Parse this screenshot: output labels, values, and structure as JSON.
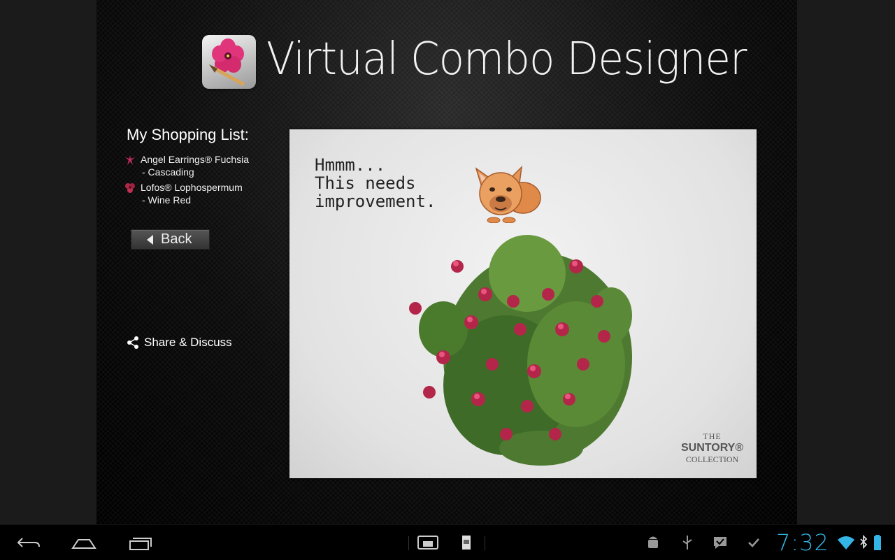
{
  "app": {
    "title": "Virtual Combo Designer",
    "logo_icon": "petunia-paintbrush-icon"
  },
  "sidebar": {
    "heading": "My Shopping List:",
    "items": [
      {
        "line1": "Angel Earrings® Fuchsia",
        "line2": "- Cascading",
        "icon": "fuchsia-flower-icon",
        "icon_color": "#c0305a"
      },
      {
        "line1": "Lofos® Lophospermum",
        "line2": "- Wine Red",
        "icon": "lophospermum-flower-icon",
        "icon_color": "#b02848"
      }
    ],
    "back_label": "Back",
    "share_label": "Share & Discuss"
  },
  "canvas": {
    "speech_lines": [
      "Hmmm...",
      "This needs",
      "improvement."
    ],
    "brand": {
      "line1": "THE",
      "line2": "SUNTORY®",
      "line3": "COLLECTION"
    }
  },
  "system_bar": {
    "time": "7:32",
    "accent_color": "#33b5e5",
    "nav_icons": [
      "back-icon",
      "home-icon",
      "recent-apps-icon"
    ],
    "center_icons": [
      "screen-compat-icon",
      "sd-card-icon"
    ],
    "status_icons": [
      "android-debug-icon",
      "usb-icon",
      "chat-icon",
      "check-icon",
      "wifi-icon",
      "bluetooth-icon",
      "battery-icon"
    ]
  }
}
